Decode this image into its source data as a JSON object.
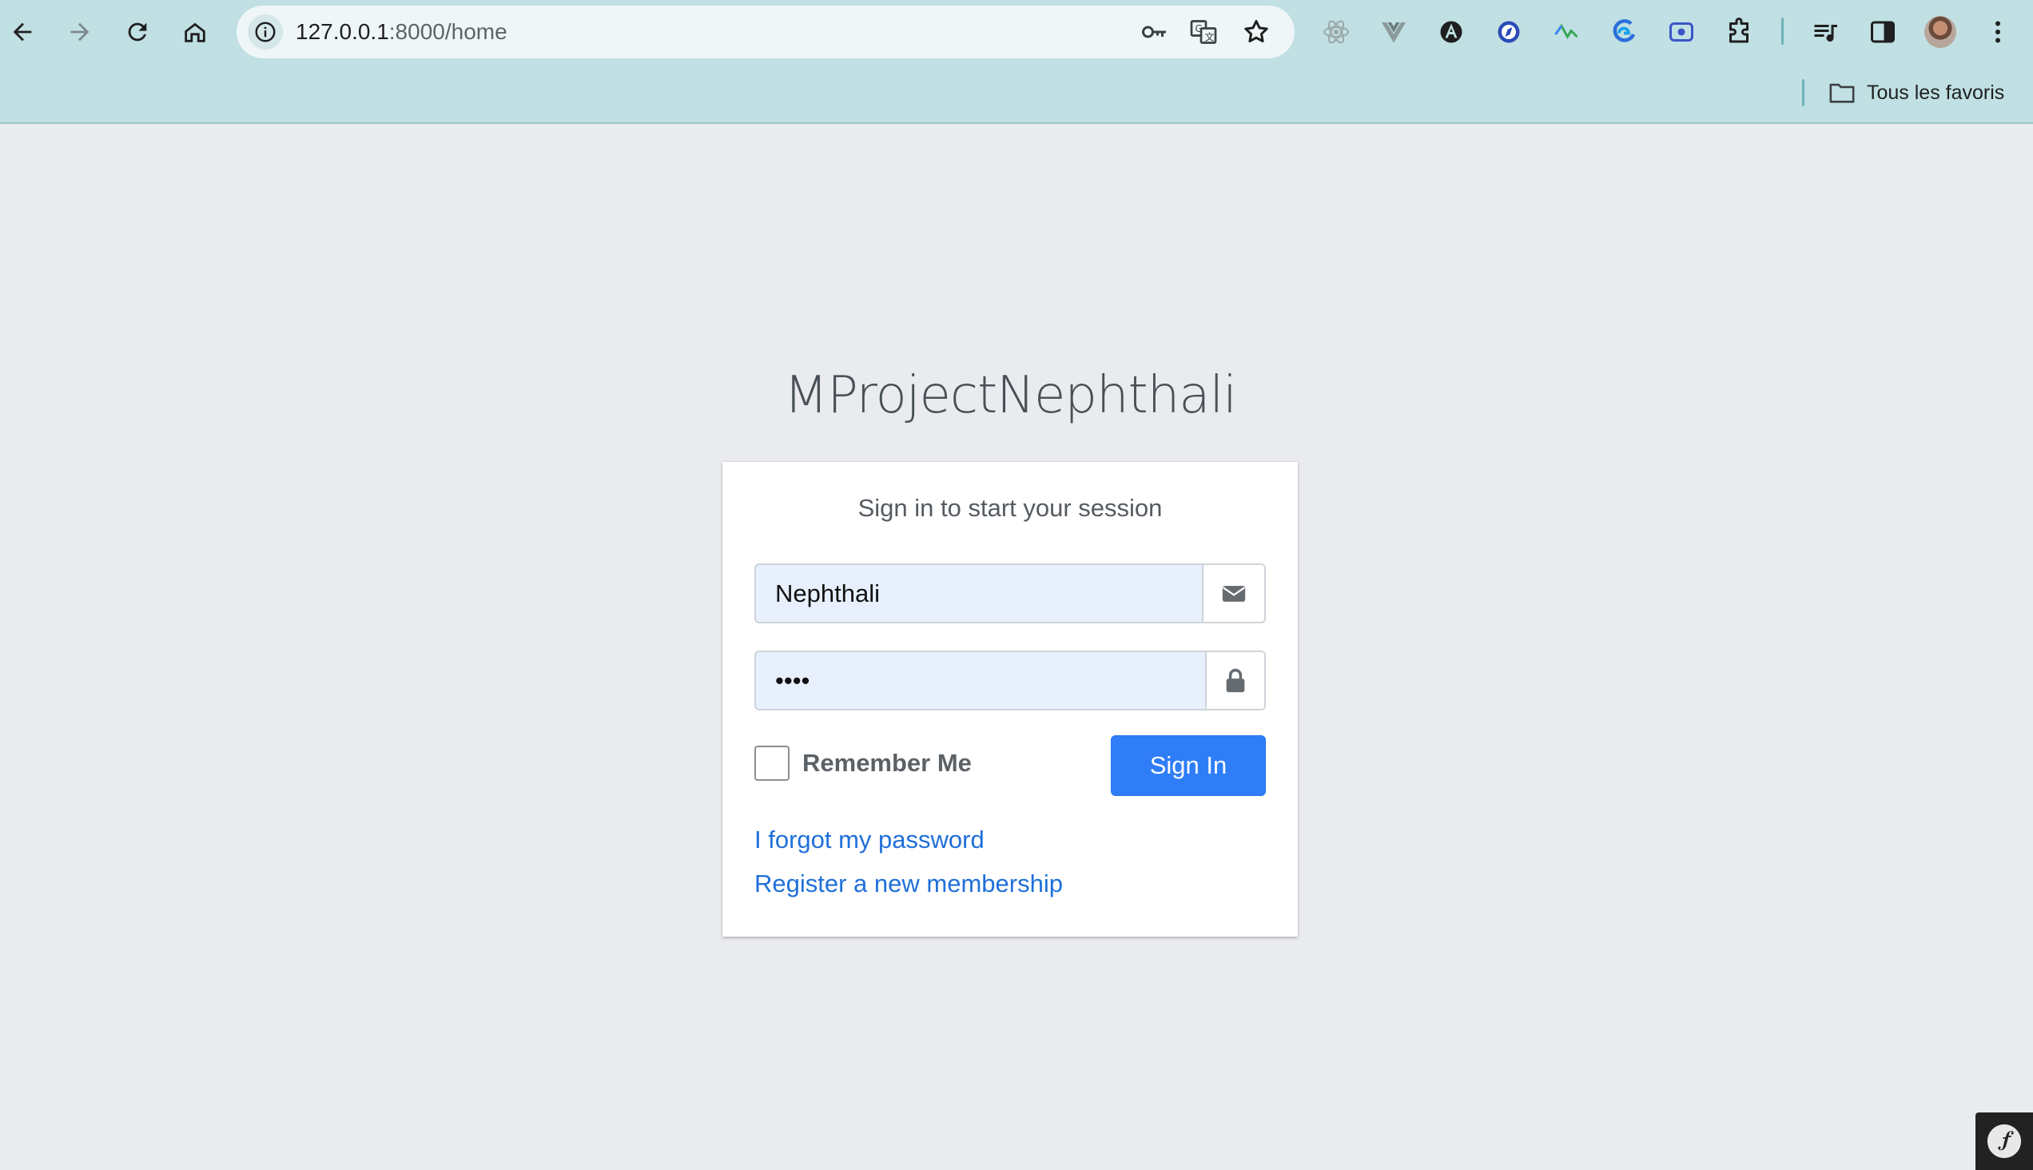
{
  "browser": {
    "url_host": "127.0.0.1",
    "url_path": ":8000/home",
    "bookmarks_folder_label": "Tous les favoris"
  },
  "page": {
    "logo_text": "MProjectNephthali",
    "login_message": "Sign in to start your session",
    "username": {
      "value": "Nephthali",
      "icon": "envelope-icon"
    },
    "password": {
      "value": "••••",
      "icon": "lock-icon"
    },
    "remember_me_label": "Remember Me",
    "remember_me_checked": false,
    "sign_in_label": "Sign In",
    "forgot_password_label": "I forgot my password",
    "register_label": "Register a new membership"
  },
  "colors": {
    "page_background": "#e9ebee",
    "chrome_background": "#c0e0e3",
    "primary_button": "#2f7ef7",
    "link": "#1f6fd9",
    "autofill_background": "#e8f0fe"
  }
}
